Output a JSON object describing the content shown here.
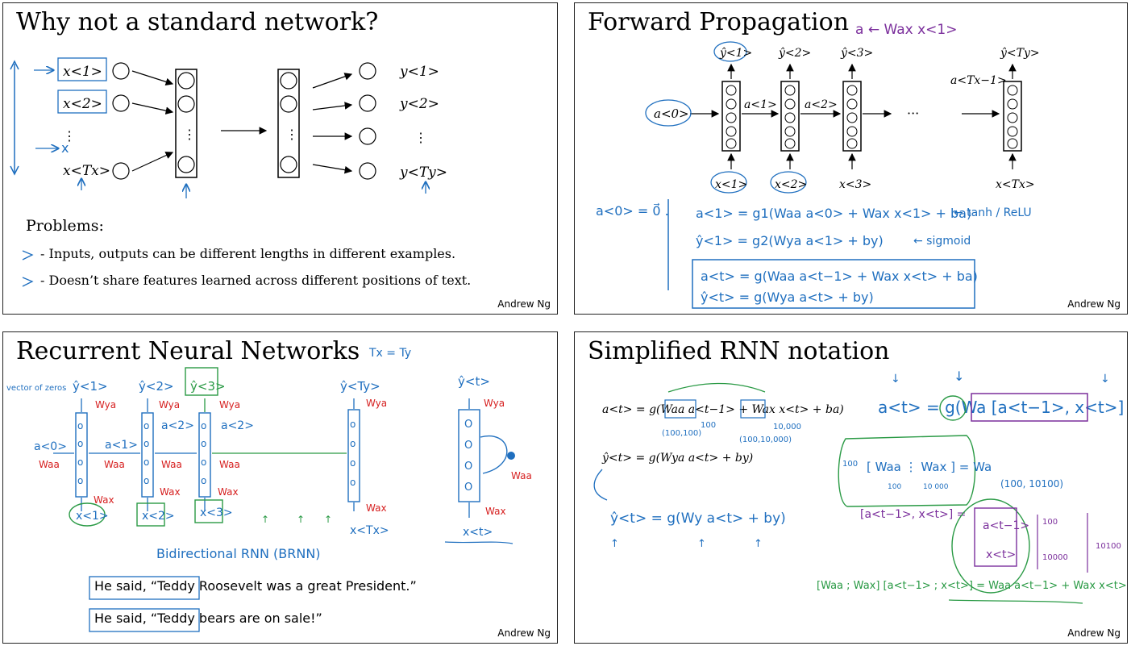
{
  "slide1": {
    "title": "Why not a standard network?",
    "inputs": [
      "x<1>",
      "x<2>",
      "x<Tx>"
    ],
    "outputs": [
      "y<1>",
      "y<2>",
      "y<Ty>"
    ],
    "dots": [
      "⋮",
      "⋮",
      "⋮"
    ],
    "problems_heading": "Problems:",
    "problem_1": "- Inputs, outputs can be different lengths in different examples.",
    "problem_2": "- Doesn’t share features learned across different positions of text.",
    "credit": "Andrew Ng"
  },
  "slide2": {
    "title": "Forward Propagation",
    "annot_top": "a ← Wax x<1>",
    "a0": "a<0>",
    "a1": "a<1>",
    "a2": "a<2>",
    "aTx": "a<Tx−1>",
    "ellipsis": "···",
    "x_labels": [
      "x<1>",
      "x<2>",
      "x<3>",
      "x<Tx>"
    ],
    "y_labels": [
      "ŷ<1>",
      "ŷ<2>",
      "ŷ<3>",
      "ŷ<Ty>"
    ],
    "a0_init": "a<0> = 0⃗ .",
    "eq1": "a<1> = g1(Waa a<0> + Wax x<1> + ba)",
    "eq1_note": "← tanh / ReLU",
    "eq2": "ŷ<1> = g2(Wya a<1> + by)",
    "eq2_note": "← sigmoid",
    "eq3": "a<t> = g(Waa a<t−1> + Wax x<t> + ba)",
    "eq4": "ŷ<t> = g(Wya a<t> + by)",
    "credit": "Andrew Ng"
  },
  "slide3": {
    "title": "Recurrent Neural Networks",
    "tx_ty": "Tx = Ty",
    "vector_of_zeros": "vector of zeros",
    "a0": "a<0>",
    "a1": "a<1>",
    "a2": "a<2>",
    "a3": "a<2>",
    "y_labels": [
      "ŷ<1>",
      "ŷ<2>",
      "ŷ<3>",
      "ŷ<Ty>",
      "ŷ<t>"
    ],
    "x_labels": [
      "x<1>",
      "x<2>",
      "x<3>",
      "x<Tx>",
      "x<t>"
    ],
    "wya": "Wya",
    "waa": "Waa",
    "wax": "Wax",
    "brnn": "Bidirectional RNN (BRNN)",
    "ex1": "He said, “Teddy Roosevelt was a great President.”",
    "ex2": "He said, “Teddy bears are on sale!”",
    "credit": "Andrew Ng"
  },
  "slide4": {
    "title": "Simplified RNN notation",
    "eq_a": "a<t> = g(Waa a<t−1> + Wax x<t> + ba)",
    "eq_a_dim1": "(100,100)",
    "eq_a_dim2": "100",
    "eq_a_dim3": "(100,10,000)",
    "eq_a_dim4": "10,000",
    "eq_y": "ŷ<t> = g(Wya a<t> + by)",
    "hw_y": "ŷ<t> = g(Wy a<t> + by)",
    "hw_a": "a<t> = g(Wa [a<t−1>, x<t>] + ba)",
    "wa_def": "[ Waa ⋮ Wax ] = Wa",
    "wa_100": "100",
    "wa_sub1": "100",
    "wa_sub2": "10 000",
    "wa_dims": "(100, 10100)",
    "stack_lhs": "[a<t−1>, x<t>] =",
    "stack_top": "a<t−1>",
    "stack_bot": "x<t>",
    "stack_100": "100",
    "stack_10000": "10000",
    "stack_10100": "10100",
    "bottom_eq": "[Waa ; Wax] [a<t−1> ; x<t>] = Waa a<t−1> + Wax x<t>",
    "credit": "Andrew Ng"
  }
}
